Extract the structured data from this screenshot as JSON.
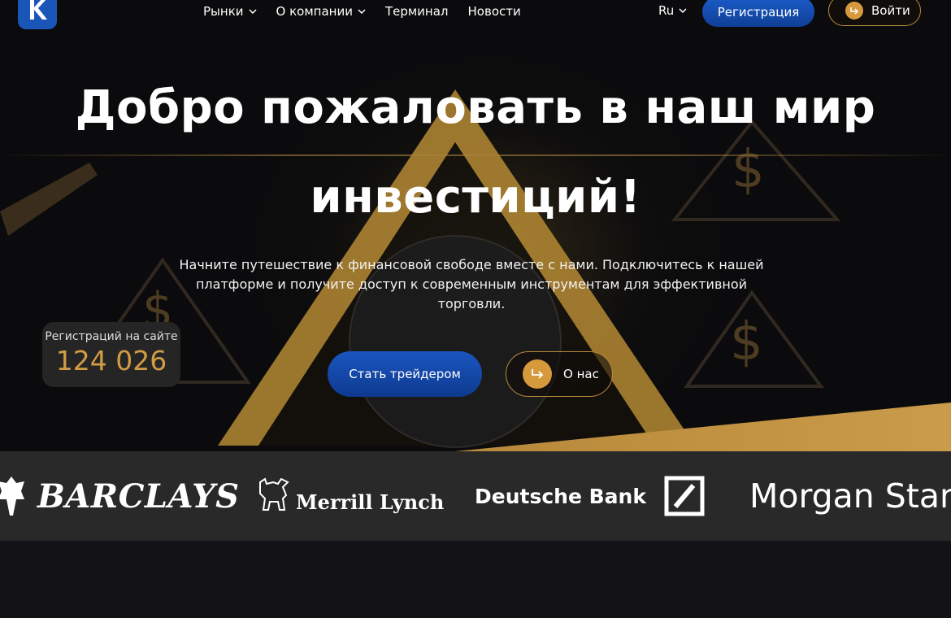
{
  "header": {
    "nav": [
      {
        "label": "Рынки",
        "dropdown": true
      },
      {
        "label": "О компании",
        "dropdown": true
      },
      {
        "label": "Терминал",
        "dropdown": false
      },
      {
        "label": "Новости",
        "dropdown": false
      }
    ],
    "language": "Ru",
    "register_label": "Регистрация",
    "login_label": "Войти"
  },
  "hero": {
    "title_line1": "Добро пожаловать в наш мир",
    "title_line2": "инвестиций!",
    "subtitle": "Начните путешествие к финансовой свободе вместе с нами. Подключитесь к нашей платформе и получите доступ к современным инструментам для эффективной торговли.",
    "cta_primary": "Стать трейдером",
    "cta_secondary": "О нас"
  },
  "stats": {
    "label": "Регистраций на сайте",
    "value": "124 026"
  },
  "partners": {
    "barclays": "BARCLAYS",
    "merrill": "Merrill Lynch",
    "deutsche": "Deutsche Bank",
    "morgan": "Morgan Stanl"
  },
  "colors": {
    "accent_gold": "#d69a3c",
    "primary_blue": "#1a56c0",
    "strip_bg": "#2a292a"
  }
}
